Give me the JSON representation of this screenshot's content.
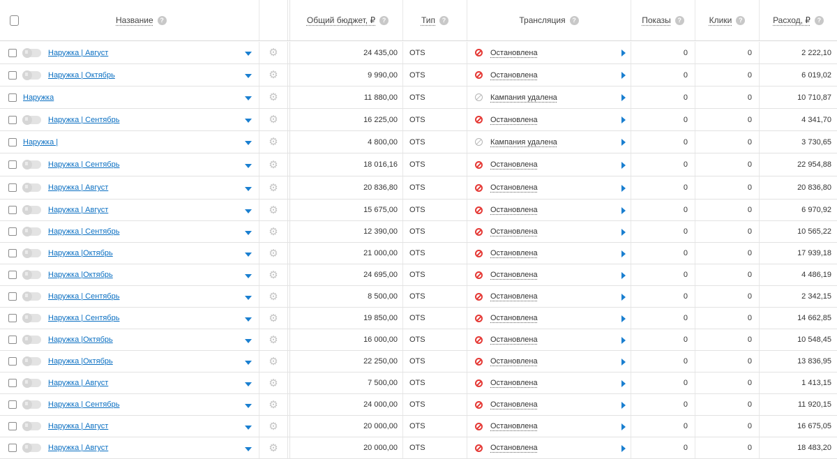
{
  "header": {
    "name": "Название",
    "budget": "Общий бюджет, ₽",
    "type": "Тип",
    "translation": "Трансляция",
    "shows": "Показы",
    "clicks": "Клики",
    "spend": "Расход, ₽",
    "help_glyph": "?"
  },
  "gear_glyph": "⚙",
  "status_colors": {
    "stopped": "#e53935",
    "deleted": "#b5b5b5",
    "link": "#0a6fc2",
    "accent": "#1a7fd0"
  },
  "rows": [
    {
      "toggle": true,
      "name": "Наружка | Август",
      "budget": "24 435,00",
      "type": "OTS",
      "status": "Остановлена",
      "status_kind": "stopped",
      "shows": "0",
      "clicks": "0",
      "spend": "2 222,10"
    },
    {
      "toggle": true,
      "name": "Наружка | Октябрь",
      "budget": "9 990,00",
      "type": "OTS",
      "status": "Остановлена",
      "status_kind": "stopped",
      "shows": "0",
      "clicks": "0",
      "spend": "6 019,02"
    },
    {
      "toggle": false,
      "name": "Наружка",
      "budget": "11 880,00",
      "type": "OTS",
      "status": "Кампания удалена",
      "status_kind": "deleted",
      "shows": "0",
      "clicks": "0",
      "spend": "10 710,87"
    },
    {
      "toggle": true,
      "name": "Наружка | Сентябрь",
      "budget": "16 225,00",
      "type": "OTS",
      "status": "Остановлена",
      "status_kind": "stopped",
      "shows": "0",
      "clicks": "0",
      "spend": "4 341,70"
    },
    {
      "toggle": false,
      "name": "Наружка |",
      "budget": "4 800,00",
      "type": "OTS",
      "status": "Кампания удалена",
      "status_kind": "deleted",
      "shows": "0",
      "clicks": "0",
      "spend": "3 730,65"
    },
    {
      "toggle": true,
      "name": "Наружка | Сентябрь",
      "budget": "18 016,16",
      "type": "OTS",
      "status": "Остановлена",
      "status_kind": "stopped",
      "shows": "0",
      "clicks": "0",
      "spend": "22 954,88"
    },
    {
      "toggle": true,
      "name": "Наружка | Август",
      "budget": "20 836,80",
      "type": "OTS",
      "status": "Остановлена",
      "status_kind": "stopped",
      "shows": "0",
      "clicks": "0",
      "spend": "20 836,80"
    },
    {
      "toggle": true,
      "name": "Наружка | Август",
      "budget": "15 675,00",
      "type": "OTS",
      "status": "Остановлена",
      "status_kind": "stopped",
      "shows": "0",
      "clicks": "0",
      "spend": "6 970,92"
    },
    {
      "toggle": true,
      "name": "Наружка | Сентябрь",
      "budget": "12 390,00",
      "type": "OTS",
      "status": "Остановлена",
      "status_kind": "stopped",
      "shows": "0",
      "clicks": "0",
      "spend": "10 565,22"
    },
    {
      "toggle": true,
      "name": "Наружка |Октябрь",
      "budget": "21 000,00",
      "type": "OTS",
      "status": "Остановлена",
      "status_kind": "stopped",
      "shows": "0",
      "clicks": "0",
      "spend": "17 939,18"
    },
    {
      "toggle": true,
      "name": "Наружка |Октябрь",
      "budget": "24 695,00",
      "type": "OTS",
      "status": "Остановлена",
      "status_kind": "stopped",
      "shows": "0",
      "clicks": "0",
      "spend": "4 486,19"
    },
    {
      "toggle": true,
      "name": "Наружка | Сентябрь",
      "budget": "8 500,00",
      "type": "OTS",
      "status": "Остановлена",
      "status_kind": "stopped",
      "shows": "0",
      "clicks": "0",
      "spend": "2 342,15"
    },
    {
      "toggle": true,
      "name": "Наружка | Сентябрь",
      "budget": "19 850,00",
      "type": "OTS",
      "status": "Остановлена",
      "status_kind": "stopped",
      "shows": "0",
      "clicks": "0",
      "spend": "14 662,85"
    },
    {
      "toggle": true,
      "name": "Наружка |Октябрь",
      "budget": "16 000,00",
      "type": "OTS",
      "status": "Остановлена",
      "status_kind": "stopped",
      "shows": "0",
      "clicks": "0",
      "spend": "10 548,45"
    },
    {
      "toggle": true,
      "name": "Наружка |Октябрь",
      "budget": "22 250,00",
      "type": "OTS",
      "status": "Остановлена",
      "status_kind": "stopped",
      "shows": "0",
      "clicks": "0",
      "spend": "13 836,95"
    },
    {
      "toggle": true,
      "name": "Наружка | Август",
      "budget": "7 500,00",
      "type": "OTS",
      "status": "Остановлена",
      "status_kind": "stopped",
      "shows": "0",
      "clicks": "0",
      "spend": "1 413,15"
    },
    {
      "toggle": true,
      "name": "Наружка | Сентябрь",
      "budget": "24 000,00",
      "type": "OTS",
      "status": "Остановлена",
      "status_kind": "stopped",
      "shows": "0",
      "clicks": "0",
      "spend": "11 920,15"
    },
    {
      "toggle": true,
      "name": "Наружка | Август",
      "budget": "20 000,00",
      "type": "OTS",
      "status": "Остановлена",
      "status_kind": "stopped",
      "shows": "0",
      "clicks": "0",
      "spend": "16 675,05"
    },
    {
      "toggle": true,
      "name": "Наружка | Август",
      "budget": "20 000,00",
      "type": "OTS",
      "status": "Остановлена",
      "status_kind": "stopped",
      "shows": "0",
      "clicks": "0",
      "spend": "18 483,20"
    }
  ]
}
